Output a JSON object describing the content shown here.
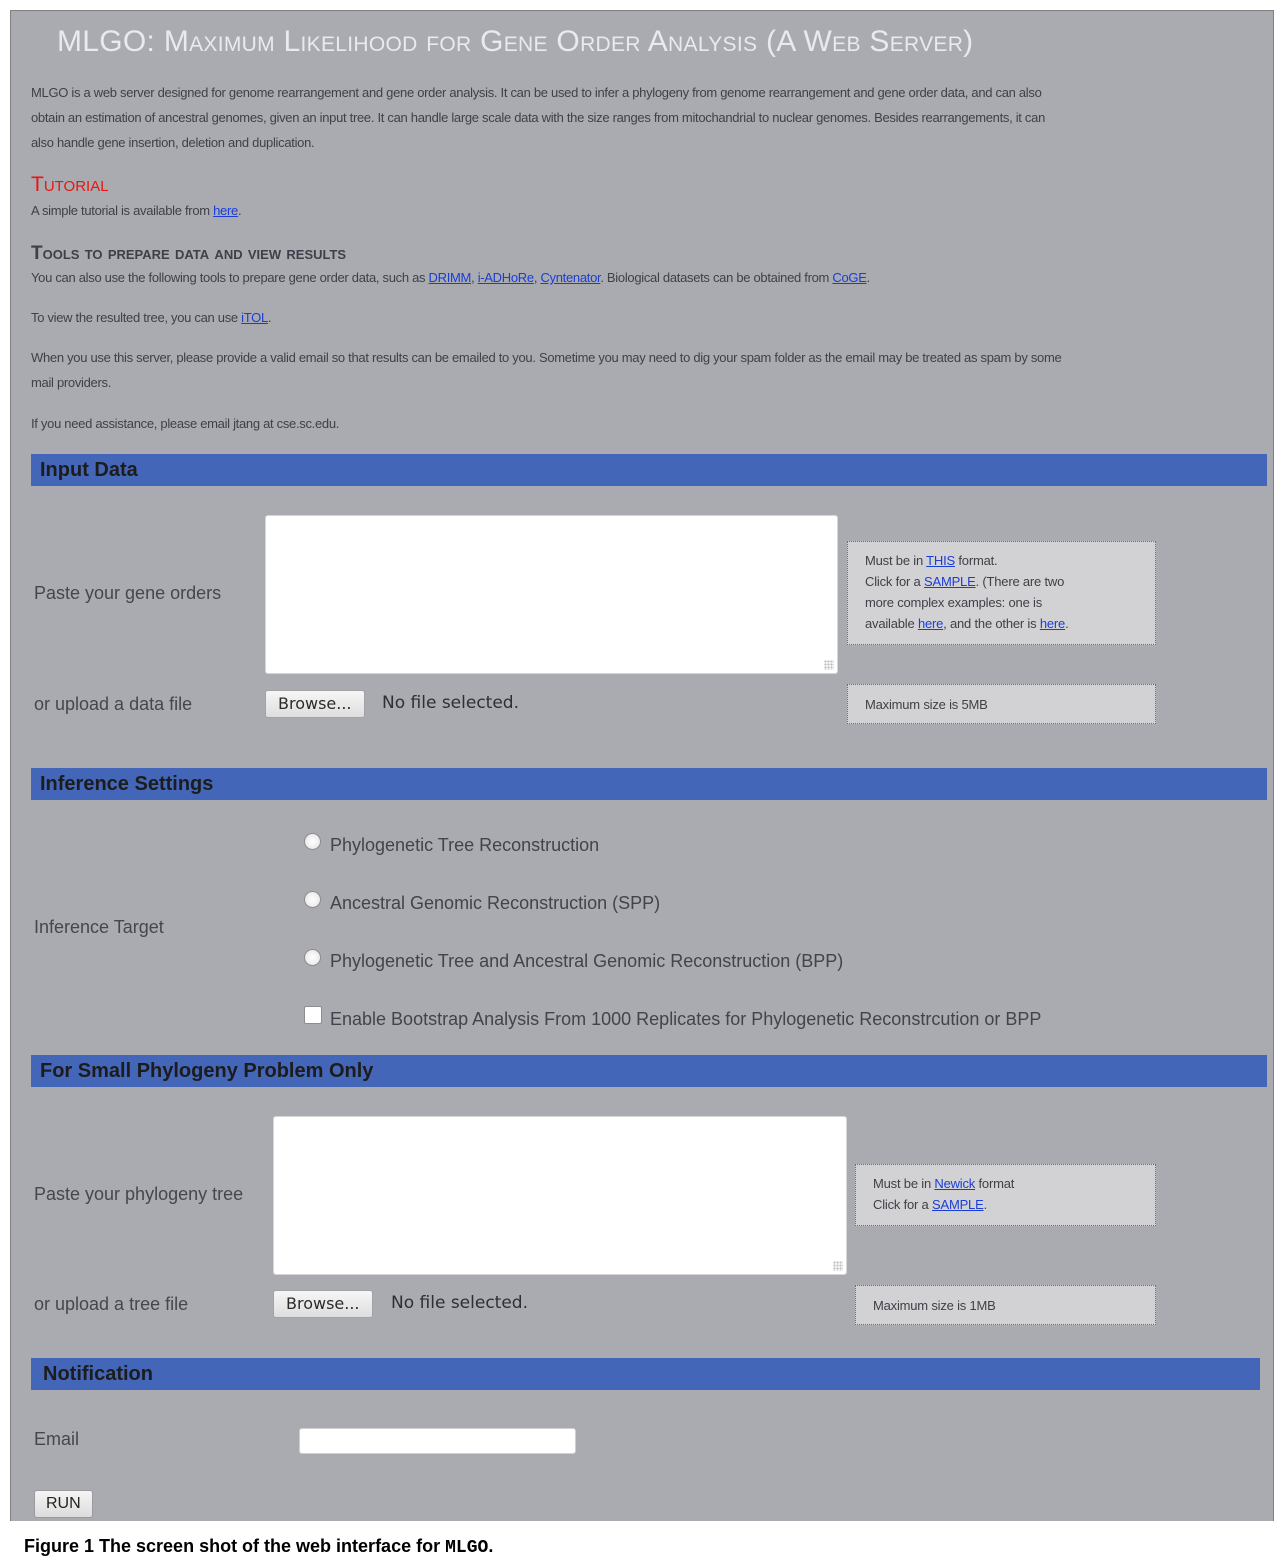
{
  "header": {
    "title": "MLGO: Maximum Likelihood for Gene Order Analysis (A Web Server)",
    "intro_lines": [
      "MLGO is a web server designed for genome rearrangement and gene order analysis. It can be used to infer a phylogeny from genome rearrangement and gene order data, and can also",
      "obtain an estimation of ancestral genomes, given an input tree. It can handle large scale data with the size ranges from mitochandrial to nuclear genomes. Besides rearrangements, it can",
      "also handle gene insertion, deletion and duplication."
    ]
  },
  "tutorial": {
    "heading": "Tutorial",
    "text_before": "A simple tutorial is available from ",
    "link": "here",
    "text_after": "."
  },
  "tools": {
    "heading": "Tools to prepare data and view results",
    "line1_before": "You can also use the following tools to prepare gene order data, such as ",
    "links": [
      "DRIMM",
      "i-ADHoRe",
      "Cyntenator"
    ],
    "sep": ", ",
    "line1_mid": ". Biological datasets can be obtained from ",
    "coge_link": "CoGE",
    "line1_after": ".",
    "line2_before": "To view the resulted tree, you can use ",
    "itol_link": "iTOL",
    "line2_after": ".",
    "line3a": "When you use this server, please provide a valid email so that results can be emailed to you. Sometime you may need to dig your spam folder as the email may be treated as spam by some",
    "line3b": "mail providers.",
    "line4": "If you need assistance, please email jtang at cse.sc.edu."
  },
  "input_data": {
    "section_title": "Input Data",
    "paste_label": "Paste your gene orders",
    "upload_label": "or upload a data file",
    "browse_label": "Browse...",
    "no_file": "No file selected.",
    "help": {
      "l1_before": "Must be in ",
      "l1_link": "THIS",
      "l1_after": " format.",
      "l2_before": "Click for a ",
      "l2_link": "SAMPLE",
      "l2_after": ". (There are two",
      "l3": "more complex examples: one is",
      "l4_before": "available ",
      "l4_link1": "here",
      "l4_mid": ", and the other is ",
      "l4_link2": "here",
      "l4_after": "."
    },
    "max_size": "Maximum size is 5MB"
  },
  "inference": {
    "section_title": "Inference Settings",
    "target_label": "Inference Target",
    "options": [
      "Phylogenetic Tree Reconstruction",
      "Ancestral Genomic Reconstruction (SPP)",
      "Phylogenetic Tree and Ancestral Genomic Reconstruction (BPP)"
    ],
    "bootstrap_label": "Enable Bootstrap Analysis From 1000 Replicates for Phylogenetic Reconstrcution or BPP"
  },
  "small_phylogeny": {
    "section_title": "For Small Phylogeny Problem Only",
    "paste_label": "Paste your phylogeny tree",
    "upload_label": "or upload a tree file",
    "browse_label": "Browse...",
    "no_file": "No file selected.",
    "help": {
      "l1_before": "Must be in ",
      "l1_link": "Newick",
      "l1_after": " format",
      "l2_before": "Click for a ",
      "l2_link": "SAMPLE",
      "l2_after": "."
    },
    "max_size": "Maximum size is 1MB"
  },
  "notification": {
    "section_title": "Notification",
    "email_label": "Email",
    "email_value": "",
    "run_label": "RUN"
  },
  "caption": {
    "prefix": "Figure 1",
    "text": " The screen shot of the web interface for ",
    "code": "MLGO",
    "suffix": "."
  },
  "colors": {
    "page_bg": "#a9abb1",
    "section_bar": "#4466b8",
    "tutorial_heading": "#e8160f",
    "link": "#1a3dd6"
  }
}
